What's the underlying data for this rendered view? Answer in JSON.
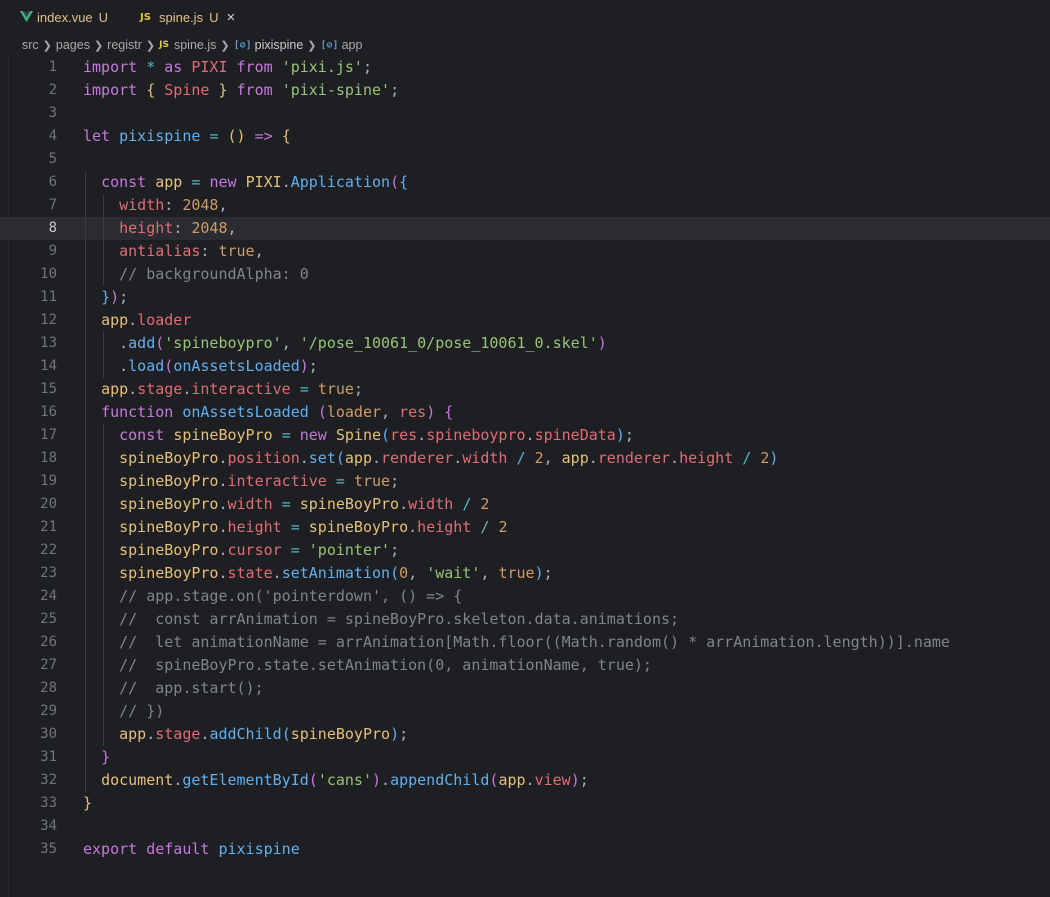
{
  "tabs": [
    {
      "label": "index.vue",
      "status": "U",
      "icon": "vue-icon"
    },
    {
      "label": "spine.js",
      "status": "U",
      "icon": "js-icon",
      "close": "×"
    }
  ],
  "breadcrumb": {
    "items": [
      "src",
      "pages",
      "registr",
      "spine.js",
      "pixispine",
      "app"
    ],
    "js_badge": "JS",
    "symbol_badge": "[⊘]"
  },
  "editor": {
    "highlight_line": 8,
    "line_numbers": [
      "1",
      "2",
      "3",
      "4",
      "5",
      "6",
      "7",
      "8",
      "9",
      "10",
      "11",
      "12",
      "13",
      "14",
      "15",
      "16",
      "17",
      "18",
      "19",
      "20",
      "21",
      "22",
      "23",
      "24",
      "25",
      "26",
      "27",
      "28",
      "29",
      "30",
      "31",
      "32",
      "33",
      "34",
      "35"
    ],
    "lines": [
      [
        [
          "kw",
          "import"
        ],
        [
          "plain",
          " "
        ],
        [
          "op",
          "*"
        ],
        [
          "plain",
          " "
        ],
        [
          "kw",
          "as"
        ],
        [
          "plain",
          " "
        ],
        [
          "pr",
          "PIXI"
        ],
        [
          "plain",
          " "
        ],
        [
          "kw",
          "from"
        ],
        [
          "plain",
          " "
        ],
        [
          "str",
          "'pixi.js'"
        ],
        [
          "plain",
          ";"
        ]
      ],
      [
        [
          "kw",
          "import"
        ],
        [
          "plain",
          " "
        ],
        [
          "br1",
          "{"
        ],
        [
          "plain",
          " "
        ],
        [
          "pr",
          "Spine"
        ],
        [
          "plain",
          " "
        ],
        [
          "br1",
          "}"
        ],
        [
          "plain",
          " "
        ],
        [
          "kw",
          "from"
        ],
        [
          "plain",
          " "
        ],
        [
          "str",
          "'pixi-spine'"
        ],
        [
          "plain",
          ";"
        ]
      ],
      [],
      [
        [
          "kw",
          "let"
        ],
        [
          "plain",
          " "
        ],
        [
          "fnv",
          "pixispine"
        ],
        [
          "plain",
          " "
        ],
        [
          "op",
          "="
        ],
        [
          "plain",
          " "
        ],
        [
          "br1",
          "()"
        ],
        [
          "plain",
          " "
        ],
        [
          "kw",
          "=>"
        ],
        [
          "plain",
          " "
        ],
        [
          "br1",
          "{"
        ]
      ],
      [],
      [
        [
          "plain",
          "  "
        ],
        [
          "kw",
          "const"
        ],
        [
          "plain",
          " "
        ],
        [
          "id",
          "app"
        ],
        [
          "plain",
          " "
        ],
        [
          "op",
          "="
        ],
        [
          "plain",
          " "
        ],
        [
          "kw",
          "new"
        ],
        [
          "plain",
          " "
        ],
        [
          "id",
          "PIXI"
        ],
        [
          "plain",
          "."
        ],
        [
          "fn",
          "Application"
        ],
        [
          "br2",
          "("
        ],
        [
          "br3",
          "{"
        ]
      ],
      [
        [
          "plain",
          "    "
        ],
        [
          "pr",
          "width"
        ],
        [
          "plain",
          ": "
        ],
        [
          "num",
          "2048"
        ],
        [
          "plain",
          ","
        ]
      ],
      [
        [
          "plain",
          "    "
        ],
        [
          "pr",
          "height"
        ],
        [
          "plain",
          ": "
        ],
        [
          "num",
          "2048"
        ],
        [
          "plain",
          ","
        ]
      ],
      [
        [
          "plain",
          "    "
        ],
        [
          "pr",
          "antialias"
        ],
        [
          "plain",
          ": "
        ],
        [
          "num",
          "true"
        ],
        [
          "plain",
          ","
        ]
      ],
      [
        [
          "plain",
          "    "
        ],
        [
          "cm",
          "// backgroundAlpha: 0"
        ]
      ],
      [
        [
          "plain",
          "  "
        ],
        [
          "br3",
          "}"
        ],
        [
          "br2",
          ")"
        ],
        [
          "plain",
          ";"
        ]
      ],
      [
        [
          "plain",
          "  "
        ],
        [
          "id",
          "app"
        ],
        [
          "plain",
          "."
        ],
        [
          "pr",
          "loader"
        ]
      ],
      [
        [
          "plain",
          "    ."
        ],
        [
          "fn",
          "add"
        ],
        [
          "br2",
          "("
        ],
        [
          "str",
          "'spineboypro'"
        ],
        [
          "plain",
          ", "
        ],
        [
          "str",
          "'/pose_10061_0/pose_10061_0.skel'"
        ],
        [
          "br2",
          ")"
        ]
      ],
      [
        [
          "plain",
          "    ."
        ],
        [
          "fn",
          "load"
        ],
        [
          "br2",
          "("
        ],
        [
          "fn",
          "onAssetsLoaded"
        ],
        [
          "br2",
          ")"
        ],
        [
          "plain",
          ";"
        ]
      ],
      [
        [
          "plain",
          "  "
        ],
        [
          "id",
          "app"
        ],
        [
          "plain",
          "."
        ],
        [
          "pr",
          "stage"
        ],
        [
          "plain",
          "."
        ],
        [
          "pr",
          "interactive"
        ],
        [
          "plain",
          " "
        ],
        [
          "op",
          "="
        ],
        [
          "plain",
          " "
        ],
        [
          "num",
          "true"
        ],
        [
          "plain",
          ";"
        ]
      ],
      [
        [
          "plain",
          "  "
        ],
        [
          "kw",
          "function"
        ],
        [
          "plain",
          " "
        ],
        [
          "fn",
          "onAssetsLoaded"
        ],
        [
          "plain",
          " "
        ],
        [
          "br2",
          "("
        ],
        [
          "param",
          "loader"
        ],
        [
          "plain",
          ", "
        ],
        [
          "idv",
          "res"
        ],
        [
          "br2",
          ")"
        ],
        [
          "plain",
          " "
        ],
        [
          "br2",
          "{"
        ]
      ],
      [
        [
          "plain",
          "    "
        ],
        [
          "kw",
          "const"
        ],
        [
          "plain",
          " "
        ],
        [
          "id",
          "spineBoyPro"
        ],
        [
          "plain",
          " "
        ],
        [
          "op",
          "="
        ],
        [
          "plain",
          " "
        ],
        [
          "kw",
          "new"
        ],
        [
          "plain",
          " "
        ],
        [
          "id",
          "Spine"
        ],
        [
          "br3",
          "("
        ],
        [
          "idv",
          "res"
        ],
        [
          "plain",
          "."
        ],
        [
          "pr",
          "spineboypro"
        ],
        [
          "plain",
          "."
        ],
        [
          "pr",
          "spineData"
        ],
        [
          "br3",
          ")"
        ],
        [
          "plain",
          ";"
        ]
      ],
      [
        [
          "plain",
          "    "
        ],
        [
          "id",
          "spineBoyPro"
        ],
        [
          "plain",
          "."
        ],
        [
          "pr",
          "position"
        ],
        [
          "plain",
          "."
        ],
        [
          "fn",
          "set"
        ],
        [
          "br3",
          "("
        ],
        [
          "id",
          "app"
        ],
        [
          "plain",
          "."
        ],
        [
          "pr",
          "renderer"
        ],
        [
          "plain",
          "."
        ],
        [
          "pr",
          "width"
        ],
        [
          "plain",
          " "
        ],
        [
          "op",
          "/"
        ],
        [
          "plain",
          " "
        ],
        [
          "num",
          "2"
        ],
        [
          "plain",
          ", "
        ],
        [
          "id",
          "app"
        ],
        [
          "plain",
          "."
        ],
        [
          "pr",
          "renderer"
        ],
        [
          "plain",
          "."
        ],
        [
          "pr",
          "height"
        ],
        [
          "plain",
          " "
        ],
        [
          "op",
          "/"
        ],
        [
          "plain",
          " "
        ],
        [
          "num",
          "2"
        ],
        [
          "br3",
          ")"
        ]
      ],
      [
        [
          "plain",
          "    "
        ],
        [
          "id",
          "spineBoyPro"
        ],
        [
          "plain",
          "."
        ],
        [
          "pr",
          "interactive"
        ],
        [
          "plain",
          " "
        ],
        [
          "op",
          "="
        ],
        [
          "plain",
          " "
        ],
        [
          "num",
          "true"
        ],
        [
          "plain",
          ";"
        ]
      ],
      [
        [
          "plain",
          "    "
        ],
        [
          "id",
          "spineBoyPro"
        ],
        [
          "plain",
          "."
        ],
        [
          "pr",
          "width"
        ],
        [
          "plain",
          " "
        ],
        [
          "op",
          "="
        ],
        [
          "plain",
          " "
        ],
        [
          "id",
          "spineBoyPro"
        ],
        [
          "plain",
          "."
        ],
        [
          "pr",
          "width"
        ],
        [
          "plain",
          " "
        ],
        [
          "op",
          "/"
        ],
        [
          "plain",
          " "
        ],
        [
          "num",
          "2"
        ]
      ],
      [
        [
          "plain",
          "    "
        ],
        [
          "id",
          "spineBoyPro"
        ],
        [
          "plain",
          "."
        ],
        [
          "pr",
          "height"
        ],
        [
          "plain",
          " "
        ],
        [
          "op",
          "="
        ],
        [
          "plain",
          " "
        ],
        [
          "id",
          "spineBoyPro"
        ],
        [
          "plain",
          "."
        ],
        [
          "pr",
          "height"
        ],
        [
          "plain",
          " "
        ],
        [
          "op",
          "/"
        ],
        [
          "plain",
          " "
        ],
        [
          "num",
          "2"
        ]
      ],
      [
        [
          "plain",
          "    "
        ],
        [
          "id",
          "spineBoyPro"
        ],
        [
          "plain",
          "."
        ],
        [
          "pr",
          "cursor"
        ],
        [
          "plain",
          " "
        ],
        [
          "op",
          "="
        ],
        [
          "plain",
          " "
        ],
        [
          "str",
          "'pointer'"
        ],
        [
          "plain",
          ";"
        ]
      ],
      [
        [
          "plain",
          "    "
        ],
        [
          "id",
          "spineBoyPro"
        ],
        [
          "plain",
          "."
        ],
        [
          "pr",
          "state"
        ],
        [
          "plain",
          "."
        ],
        [
          "fn",
          "setAnimation"
        ],
        [
          "br3",
          "("
        ],
        [
          "num",
          "0"
        ],
        [
          "plain",
          ", "
        ],
        [
          "str",
          "'wait'"
        ],
        [
          "plain",
          ", "
        ],
        [
          "num",
          "true"
        ],
        [
          "br3",
          ")"
        ],
        [
          "plain",
          ";"
        ]
      ],
      [
        [
          "plain",
          "    "
        ],
        [
          "cm",
          "// app.stage.on('pointerdown', () => {"
        ]
      ],
      [
        [
          "plain",
          "    "
        ],
        [
          "cm",
          "//  const arrAnimation = spineBoyPro.skeleton.data.animations;"
        ]
      ],
      [
        [
          "plain",
          "    "
        ],
        [
          "cm",
          "//  let animationName = arrAnimation[Math.floor((Math.random() * arrAnimation.length))].name"
        ]
      ],
      [
        [
          "plain",
          "    "
        ],
        [
          "cm",
          "//  spineBoyPro.state.setAnimation(0, animationName, true);"
        ]
      ],
      [
        [
          "plain",
          "    "
        ],
        [
          "cm",
          "//  app.start();"
        ]
      ],
      [
        [
          "plain",
          "    "
        ],
        [
          "cm",
          "// })"
        ]
      ],
      [
        [
          "plain",
          "    "
        ],
        [
          "id",
          "app"
        ],
        [
          "plain",
          "."
        ],
        [
          "pr",
          "stage"
        ],
        [
          "plain",
          "."
        ],
        [
          "fn",
          "addChild"
        ],
        [
          "br3",
          "("
        ],
        [
          "id",
          "spineBoyPro"
        ],
        [
          "br3",
          ")"
        ],
        [
          "plain",
          ";"
        ]
      ],
      [
        [
          "plain",
          "  "
        ],
        [
          "br2",
          "}"
        ]
      ],
      [
        [
          "plain",
          "  "
        ],
        [
          "id",
          "document"
        ],
        [
          "plain",
          "."
        ],
        [
          "fn",
          "getElementById"
        ],
        [
          "br2",
          "("
        ],
        [
          "str",
          "'cans'"
        ],
        [
          "br2",
          ")"
        ],
        [
          "plain",
          "."
        ],
        [
          "fn",
          "appendChild"
        ],
        [
          "br2",
          "("
        ],
        [
          "id",
          "app"
        ],
        [
          "plain",
          "."
        ],
        [
          "pr",
          "view"
        ],
        [
          "br2",
          ")"
        ],
        [
          "plain",
          ";"
        ]
      ],
      [
        [
          "br1",
          "}"
        ]
      ],
      [],
      [
        [
          "kw",
          "export"
        ],
        [
          "plain",
          " "
        ],
        [
          "kw",
          "default"
        ],
        [
          "plain",
          " "
        ],
        [
          "fnv",
          "pixispine"
        ]
      ]
    ]
  }
}
